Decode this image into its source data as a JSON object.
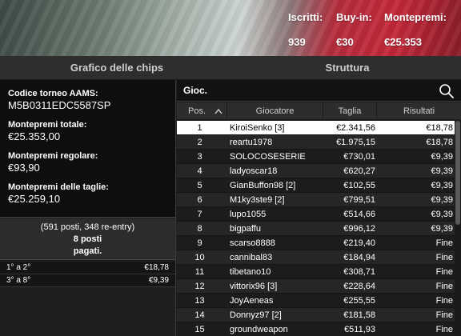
{
  "header": {
    "iscritti_label": "Iscritti:",
    "iscritti_value": "939",
    "buyin_label": "Buy-in:",
    "buyin_value": "€30",
    "montepremi_label": "Montepremi:",
    "montepremi_value": "€25.353"
  },
  "tabs": [
    {
      "label": "Grafico delle chips"
    },
    {
      "label": "Struttura"
    }
  ],
  "info": {
    "code_label": "Codice torneo AAMS:",
    "code_value": "M5B0311EDC5587SP",
    "total_label": "Montepremi totale:",
    "total_value": "€25.353,00",
    "regular_label": "Montepremi regolare:",
    "regular_value": "€93,90",
    "sizes_label": "Montepremi delle taglie:",
    "sizes_value": "€25.259,10"
  },
  "places": {
    "line1": "(591 posti, 348 re-entry)",
    "line2": "8 posti",
    "line3": "pagati."
  },
  "payouts": [
    {
      "range": "1° a 2°",
      "amount": "€18,78"
    },
    {
      "range": "3° a 8°",
      "amount": "€9,39"
    }
  ],
  "search": {
    "label": "Gioc.",
    "icon": "search-icon"
  },
  "table": {
    "columns": [
      "Pos.",
      "Giocatore",
      "Taglia",
      "Risultati"
    ],
    "sort_icon": "chevron-up-icon",
    "rows": [
      {
        "pos": "1",
        "player": "KiroiSenko [3]",
        "stack": "€2.341,56",
        "result": "€18,78"
      },
      {
        "pos": "2",
        "player": "reartu1978",
        "stack": "€1.975,15",
        "result": "€18,78"
      },
      {
        "pos": "3",
        "player": "SOLOCOSESERIE",
        "stack": "€730,01",
        "result": "€9,39"
      },
      {
        "pos": "4",
        "player": "ladyoscar18",
        "stack": "€620,27",
        "result": "€9,39"
      },
      {
        "pos": "5",
        "player": "GianBuffon98 [2]",
        "stack": "€102,55",
        "result": "€9,39"
      },
      {
        "pos": "6",
        "player": "M1ky3ste9 [2]",
        "stack": "€799,51",
        "result": "€9,39"
      },
      {
        "pos": "7",
        "player": "lupo1055",
        "stack": "€514,66",
        "result": "€9,39"
      },
      {
        "pos": "8",
        "player": "bigpaffu",
        "stack": "€996,12",
        "result": "€9,39"
      },
      {
        "pos": "9",
        "player": "scarso8888",
        "stack": "€219,40",
        "result": "Fine"
      },
      {
        "pos": "10",
        "player": "cannibal83",
        "stack": "€184,94",
        "result": "Fine"
      },
      {
        "pos": "11",
        "player": "tibetano10",
        "stack": "€308,71",
        "result": "Fine"
      },
      {
        "pos": "12",
        "player": "vittorix96 [3]",
        "stack": "€228,64",
        "result": "Fine"
      },
      {
        "pos": "13",
        "player": "JoyAeneas",
        "stack": "€255,55",
        "result": "Fine"
      },
      {
        "pos": "14",
        "player": "Donnyz97 [2]",
        "stack": "€181,58",
        "result": "Fine"
      },
      {
        "pos": "15",
        "player": "groundweapon",
        "stack": "€511,93",
        "result": "Fine"
      }
    ]
  }
}
